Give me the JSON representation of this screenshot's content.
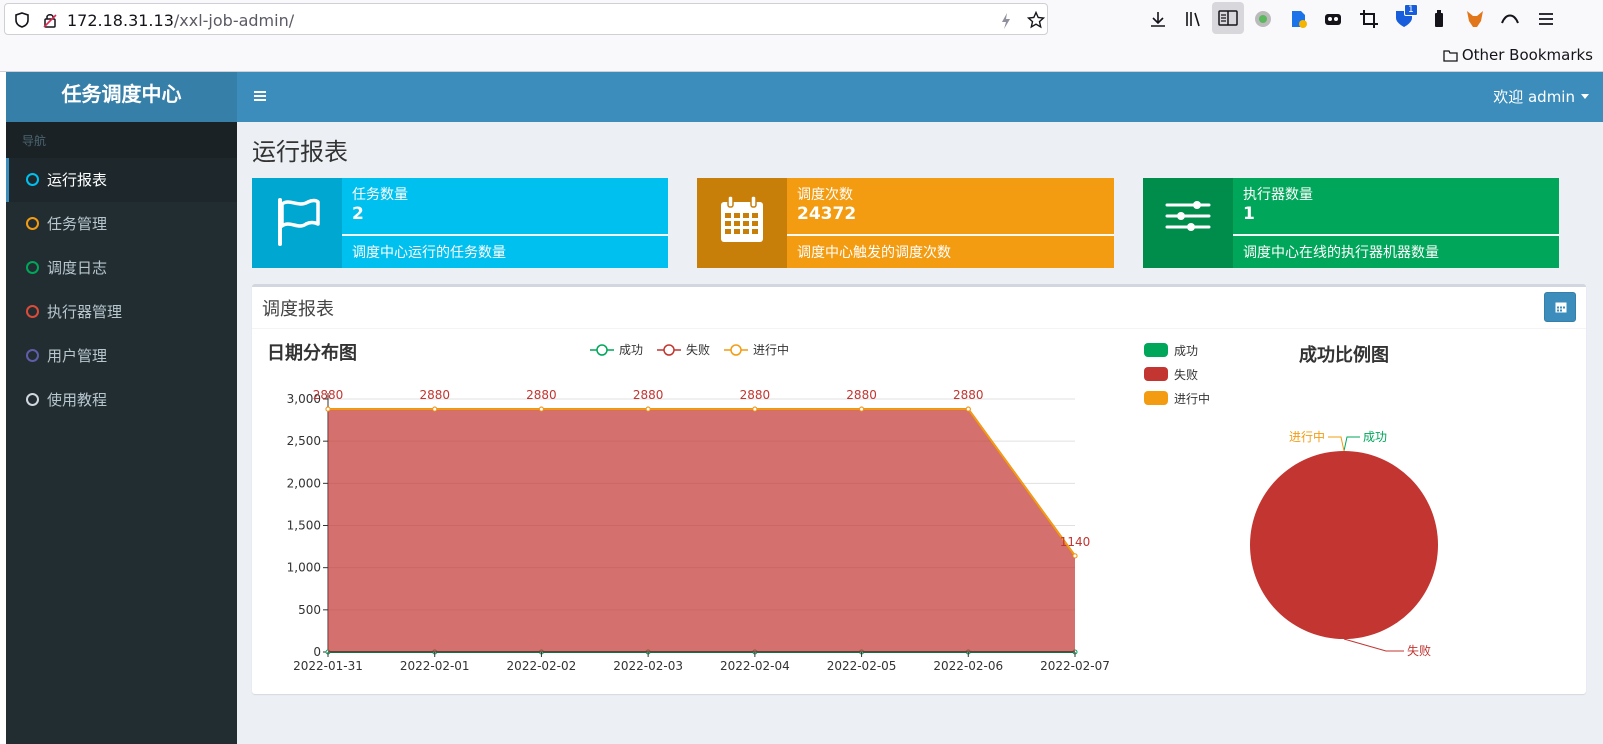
{
  "browser": {
    "url_host": "172.18.31.13",
    "url_path": "/xxl-job-admin/",
    "bookmark_other": "Other Bookmarks",
    "badge_count": "1"
  },
  "app": {
    "logo": "任务调度中心",
    "welcome": "欢迎 admin"
  },
  "sidebar": {
    "header": "导航",
    "items": [
      {
        "label": "运行报表",
        "color": "#00c0ef"
      },
      {
        "label": "任务管理",
        "color": "#f39c12"
      },
      {
        "label": "调度日志",
        "color": "#00a65a"
      },
      {
        "label": "执行器管理",
        "color": "#dd4b39"
      },
      {
        "label": "用户管理",
        "color": "#605ca8"
      },
      {
        "label": "使用教程",
        "color": "#d2d6de"
      }
    ]
  },
  "page": {
    "title": "运行报表"
  },
  "info_boxes": [
    {
      "label": "任务数量",
      "value": "2",
      "desc": "调度中心运行的任务数量",
      "icon": "flag-icon",
      "color": "#00c0ef",
      "icon_bg": "#00a7d0"
    },
    {
      "label": "调度次数",
      "value": "24372",
      "desc": "调度中心触发的调度次数",
      "icon": "calendar-icon",
      "color": "#f39c12",
      "icon_bg": "#c87f0a"
    },
    {
      "label": "执行器数量",
      "value": "1",
      "desc": "调度中心在线的执行器机器数量",
      "icon": "sliders-icon",
      "color": "#00a65a",
      "icon_bg": "#008d4c"
    }
  ],
  "report": {
    "title": "调度报表"
  },
  "chart_data": [
    {
      "type": "area",
      "title": "日期分布图",
      "categories": [
        "2022-01-31",
        "2022-02-01",
        "2022-02-02",
        "2022-02-03",
        "2022-02-04",
        "2022-02-05",
        "2022-02-06",
        "2022-02-07"
      ],
      "series": [
        {
          "name": "成功",
          "values": [
            0,
            0,
            0,
            0,
            0,
            0,
            0,
            0
          ],
          "color": "#00a65a"
        },
        {
          "name": "失败",
          "values": [
            2880,
            2880,
            2880,
            2880,
            2880,
            2880,
            2880,
            1140
          ],
          "color": "#c23531"
        },
        {
          "name": "进行中",
          "values": [
            0,
            0,
            0,
            0,
            0,
            0,
            0,
            0
          ],
          "color": "#f39c12"
        }
      ],
      "data_labels": [
        "2880",
        "2880",
        "2880",
        "2880",
        "2880",
        "2880",
        "2880",
        "1140"
      ],
      "yticks": [
        "0",
        "500",
        "1,000",
        "1,500",
        "2,000",
        "2,500",
        "3,000"
      ],
      "ylim": [
        0,
        3000
      ],
      "legend": "top-center",
      "grid": true
    },
    {
      "type": "pie",
      "title": "成功比例图",
      "labels": [
        "成功",
        "失败",
        "进行中"
      ],
      "values": [
        0,
        24372,
        0
      ],
      "colors": [
        "#00a65a",
        "#c23531",
        "#f39c12"
      ],
      "legend": "top-left"
    }
  ]
}
